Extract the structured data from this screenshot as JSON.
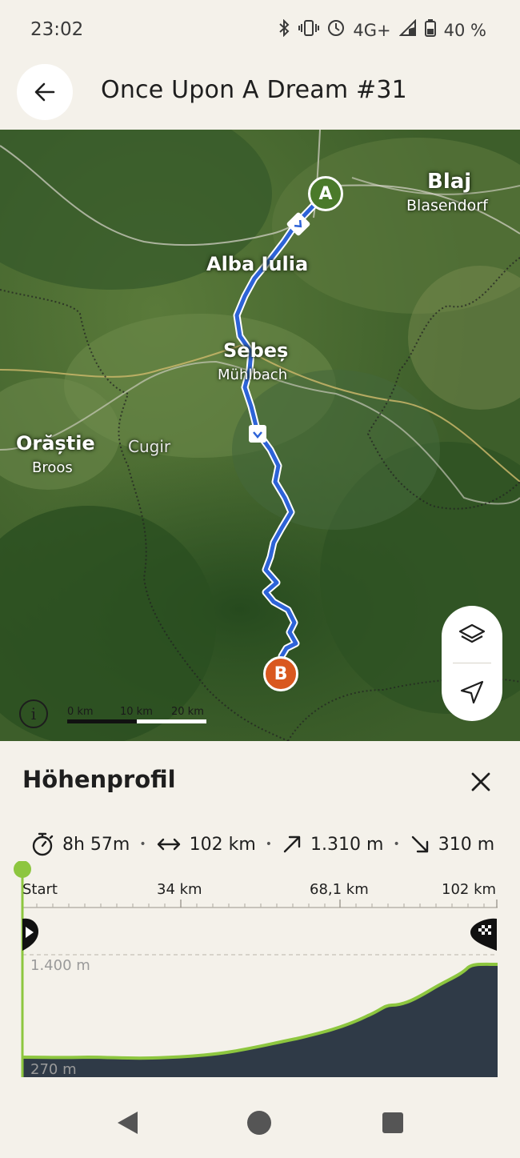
{
  "status": {
    "time": "23:02",
    "network": "4G+",
    "roaming": "R",
    "battery": "40 %"
  },
  "header": {
    "title": "Once Upon A Dream #31",
    "back_icon": "arrow-left-icon"
  },
  "map": {
    "places": [
      {
        "name": "Blaj",
        "sub": "Blasendorf"
      },
      {
        "name": "Alba Iulia",
        "sub": ""
      },
      {
        "name": "Sebeș",
        "sub": "Mühlbach"
      },
      {
        "name": "Orăștie",
        "sub": "Broos"
      },
      {
        "name": "",
        "sub": "Cugir"
      }
    ],
    "start_marker": "A",
    "end_marker": "B",
    "start_color": "#4a7a2a",
    "end_color": "#d9581f",
    "route_color": "#2d63d8",
    "scale": [
      "0 km",
      "10 km",
      "20 km"
    ],
    "controls": [
      "layers-icon",
      "navigation-arrow-icon"
    ],
    "info_icon": "info-icon"
  },
  "panel": {
    "title": "Höhenprofil",
    "close_icon": "close-icon",
    "stats": {
      "duration": "8h 57m",
      "distance": "102 km",
      "ascent": "1.310 m",
      "descent": "310 m"
    },
    "profile": {
      "km_labels": [
        "Start",
        "34 km",
        "68,1 km",
        "102 km"
      ],
      "elev_max": "1.400 m",
      "elev_min": "270 m",
      "accent": "#8dc63f",
      "fill": "#2f3a47"
    }
  },
  "navbar": {
    "back": "nav-back-icon",
    "home": "nav-home-icon",
    "recents": "nav-recents-icon"
  }
}
